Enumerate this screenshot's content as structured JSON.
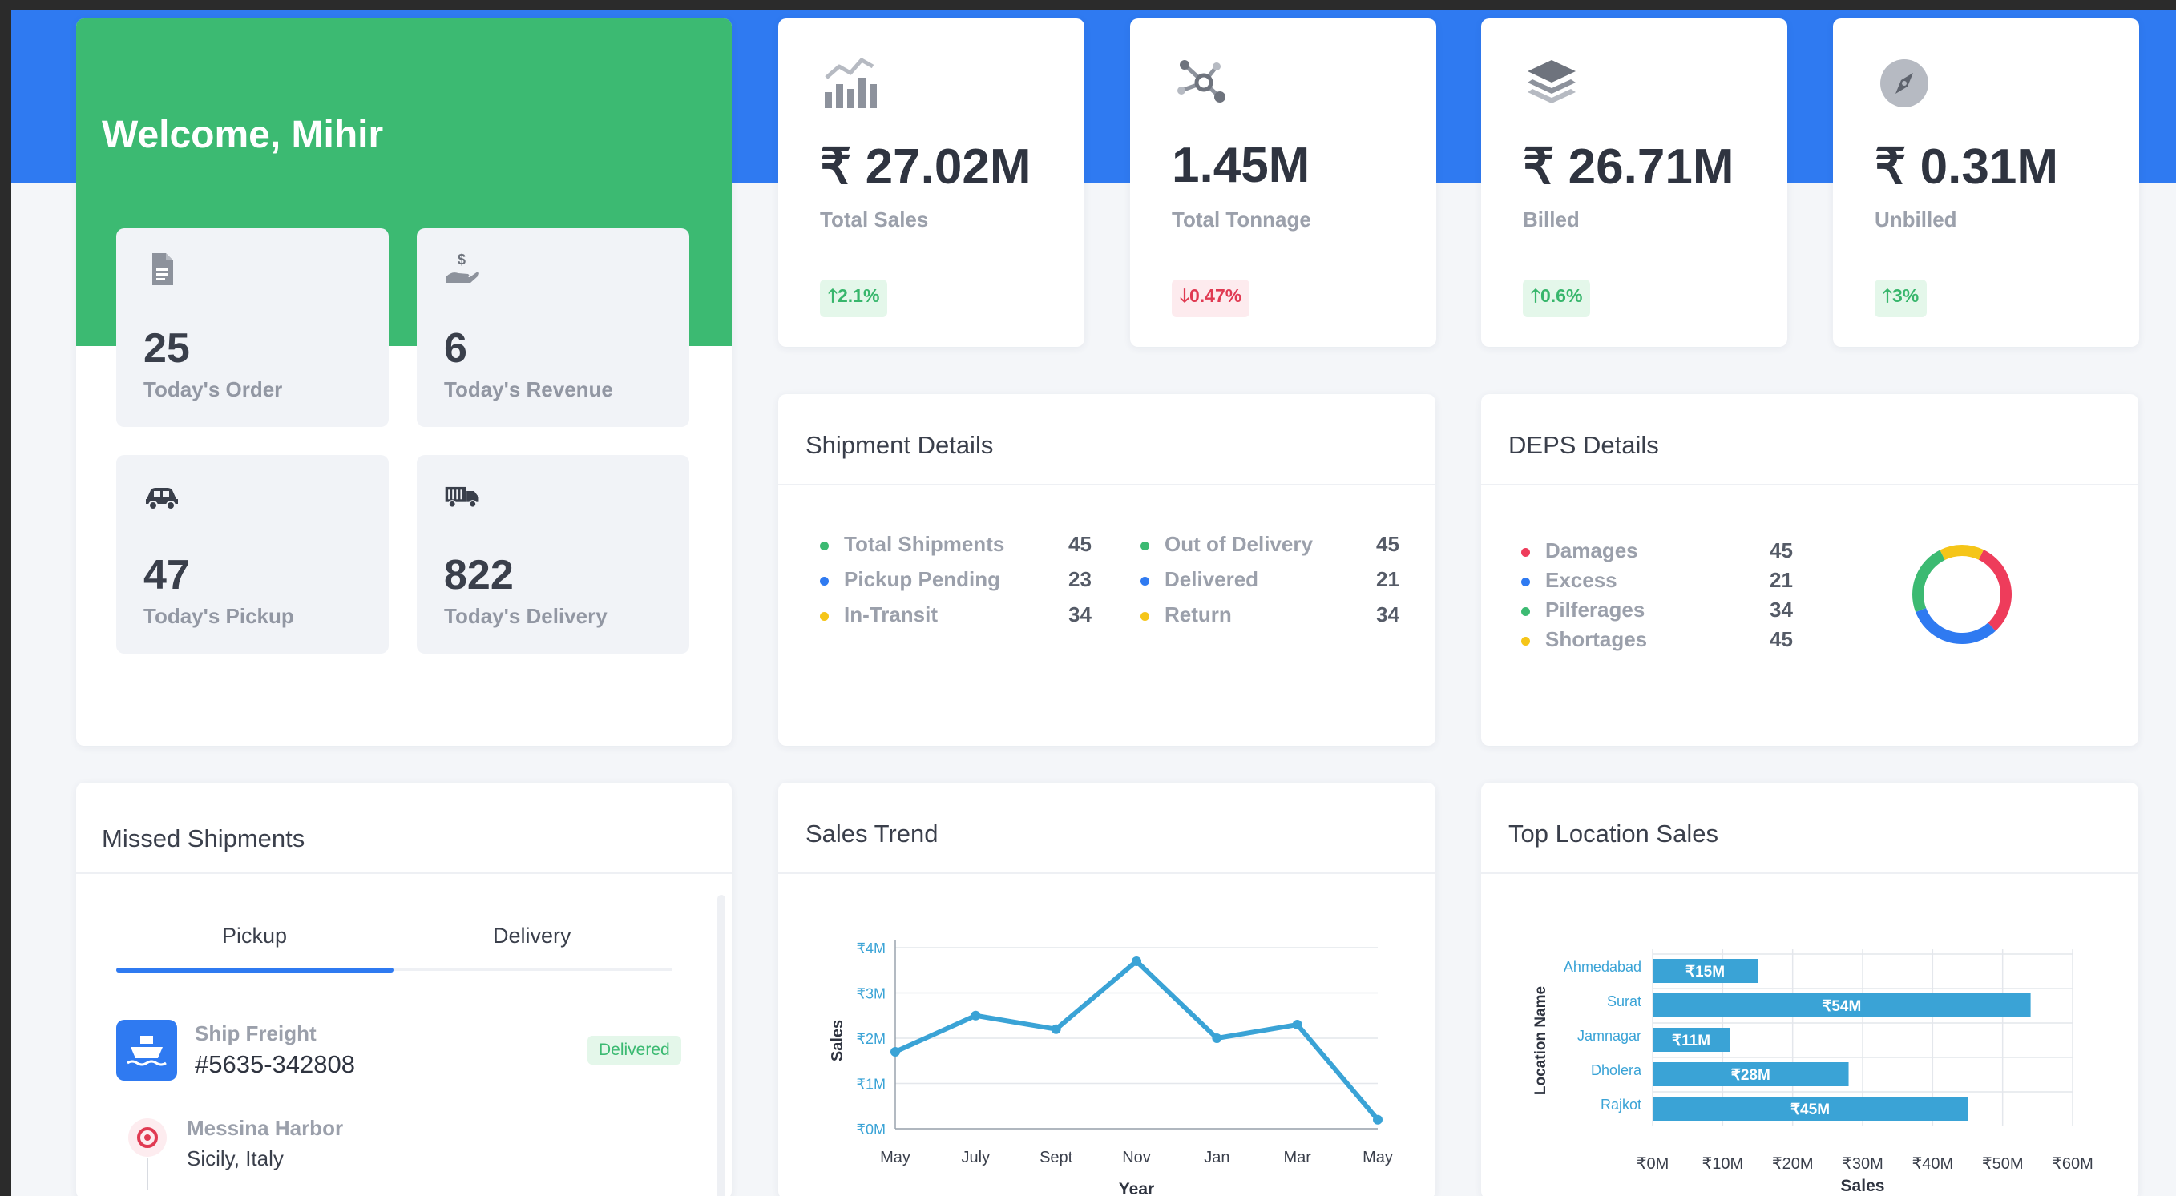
{
  "welcome": {
    "title": "Welcome, Mihir",
    "tiles": [
      {
        "value": "25",
        "label": "Today's Order",
        "icon": "document-icon"
      },
      {
        "value": "6",
        "label": "Today's Revenue",
        "icon": "money-hand-icon"
      },
      {
        "value": "47",
        "label": "Today's Pickup",
        "icon": "car-icon"
      },
      {
        "value": "822",
        "label": "Today's Delivery",
        "icon": "delivery-truck-icon"
      }
    ]
  },
  "stats": [
    {
      "value": "₹ 27.02M",
      "label": "Total Sales",
      "change": "2.1%",
      "direction": "up",
      "icon": "bar-chart-icon"
    },
    {
      "value": "1.45M",
      "label": "Total Tonnage",
      "change": "0.47%",
      "direction": "down",
      "icon": "network-nodes-icon"
    },
    {
      "value": "₹ 26.71M",
      "label": "Billed",
      "change": "0.6%",
      "direction": "up",
      "icon": "layers-icon"
    },
    {
      "value": "₹ 0.31M",
      "label": "Unbilled",
      "change": "3%",
      "direction": "up",
      "icon": "compass-icon"
    }
  ],
  "shipment": {
    "title": "Shipment Details",
    "left": [
      {
        "name": "Total Shipments",
        "count": "45",
        "color": "#3cba72"
      },
      {
        "name": "Pickup Pending",
        "count": "23",
        "color": "#2f7af1"
      },
      {
        "name": "In-Transit",
        "count": "34",
        "color": "#f5c518"
      }
    ],
    "right": [
      {
        "name": "Out of Delivery",
        "count": "45",
        "color": "#3cba72"
      },
      {
        "name": "Delivered",
        "count": "21",
        "color": "#2f7af1"
      },
      {
        "name": "Return",
        "count": "34",
        "color": "#f5c518"
      }
    ]
  },
  "deps": {
    "title": "DEPS Details",
    "items": [
      {
        "name": "Damages",
        "count": "45",
        "color": "#ee3c5b"
      },
      {
        "name": "Excess",
        "count": "21",
        "color": "#2f7af1"
      },
      {
        "name": "Pilferages",
        "count": "34",
        "color": "#3cba72"
      },
      {
        "name": "Shortages",
        "count": "45",
        "color": "#f5c518"
      }
    ],
    "donut": [
      {
        "name": "Damages",
        "value": 45,
        "color": "#ee3c5b"
      },
      {
        "name": "Excess",
        "value": 45,
        "color": "#2f7af1"
      },
      {
        "name": "Pilferages",
        "value": 34,
        "color": "#3cba72"
      },
      {
        "name": "Shortages",
        "value": 21,
        "color": "#f5c518"
      }
    ]
  },
  "missed": {
    "title": "Missed Shipments",
    "tabs": [
      "Pickup",
      "Delivery"
    ],
    "active_tab": "Pickup",
    "item": {
      "type": "Ship Freight",
      "id": "#5635-342808",
      "status": "Delivered"
    },
    "location": {
      "place": "Messina Harbor",
      "region": "Sicily, Italy"
    }
  },
  "sales_trend": {
    "title": "Sales Trend"
  },
  "top_location": {
    "title": "Top Location Sales"
  },
  "chart_data": [
    {
      "type": "line",
      "title": "Sales Trend",
      "xlabel": "Year",
      "ylabel": "Sales",
      "categories": [
        "May",
        "July",
        "Sept",
        "Nov",
        "Jan",
        "Mar",
        "May"
      ],
      "yticks": [
        "₹0M",
        "₹1M",
        "₹2M",
        "₹3M",
        "₹4M"
      ],
      "ylim": [
        0,
        4
      ],
      "series": [
        {
          "values": [
            1.7,
            2.5,
            2.2,
            3.7,
            2.0,
            2.3,
            0.2
          ]
        }
      ],
      "color": "#3aa3d6",
      "grid": true
    },
    {
      "type": "bar",
      "orientation": "horizontal",
      "title": "Top Location Sales",
      "xlabel": "Sales",
      "ylabel": "Location Name",
      "categories": [
        "Ahmedabad",
        "Surat",
        "Jamnagar",
        "Dholera",
        "Rajkot"
      ],
      "values": [
        15,
        54,
        11,
        28,
        45
      ],
      "labels": [
        "₹15M",
        "₹54M",
        "₹11M",
        "₹28M",
        "₹45M"
      ],
      "xticks": [
        "₹0M",
        "₹10M",
        "₹20M",
        "₹30M",
        "₹40M",
        "₹50M",
        "₹60M"
      ],
      "xlim": [
        0,
        60
      ],
      "color": "#3aa3d6",
      "grid": true
    }
  ]
}
